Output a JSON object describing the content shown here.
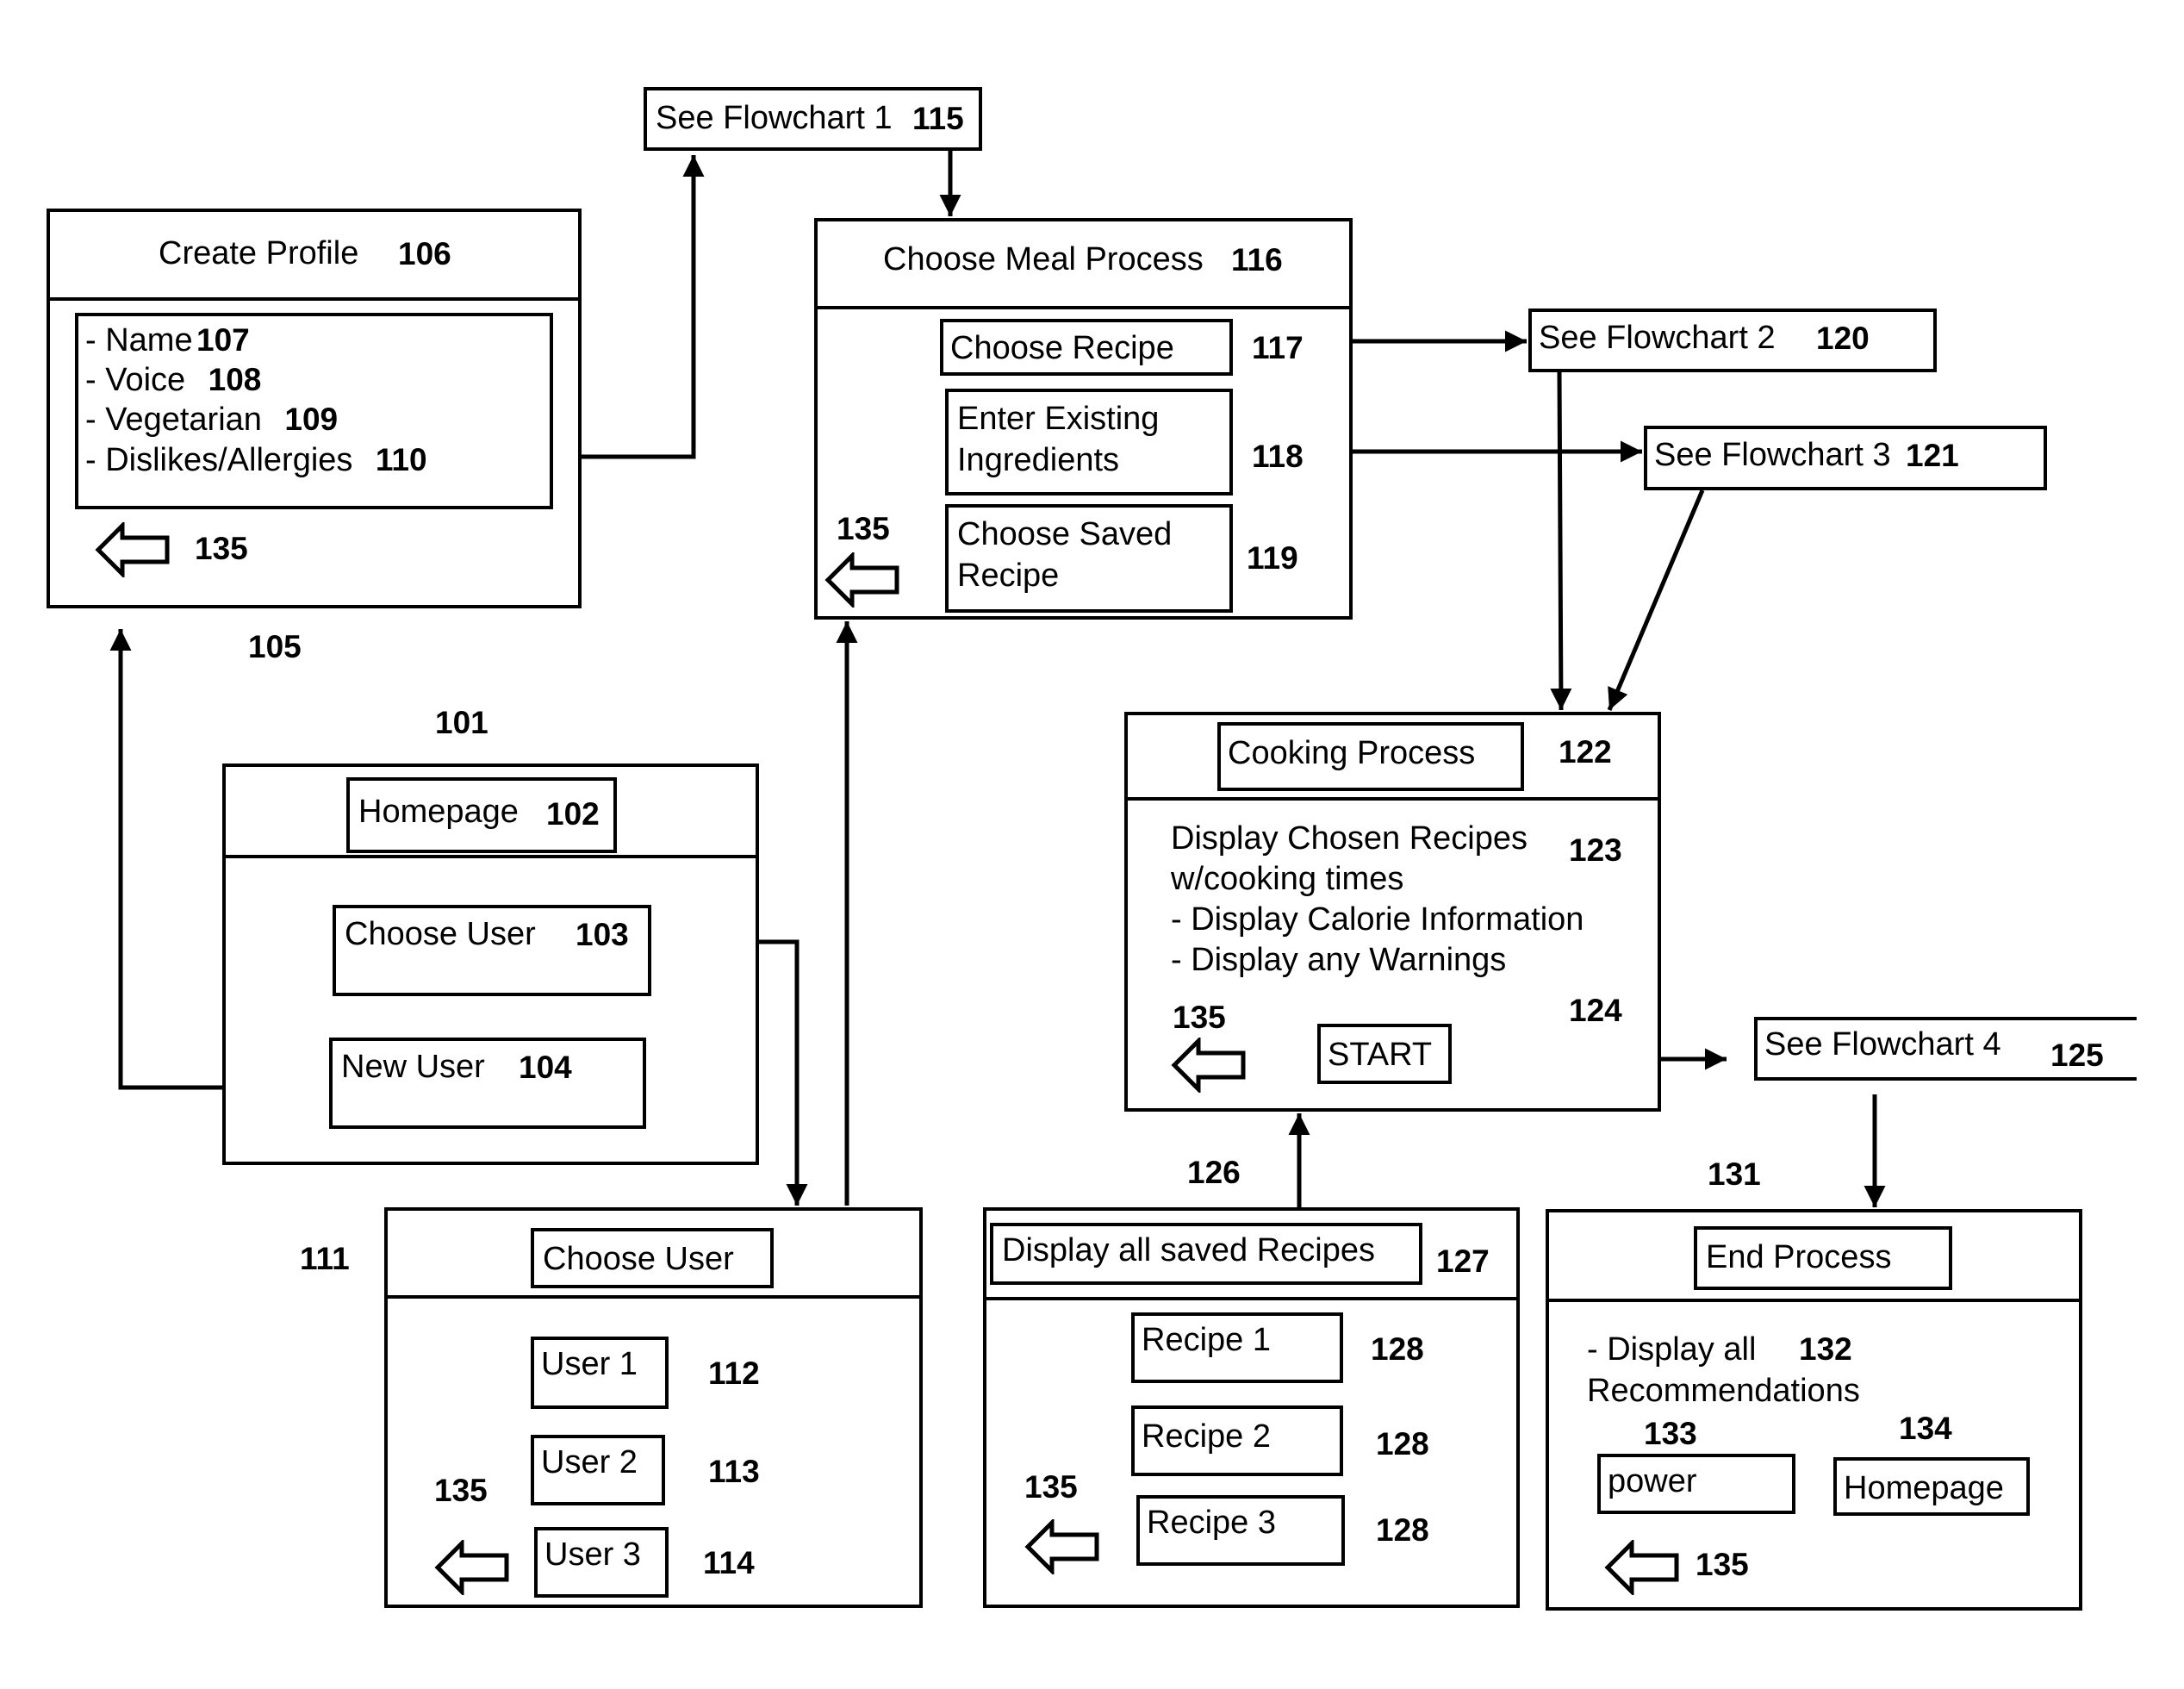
{
  "diagram": {
    "flowchart_refs": {
      "fc1": {
        "label": "See Flowchart 1",
        "ref": "115"
      },
      "fc2": {
        "label": "See Flowchart 2",
        "ref": "120"
      },
      "fc3": {
        "label": "See Flowchart 3",
        "ref": "121"
      },
      "fc4": {
        "label": "See Flowchart 4",
        "ref": "125"
      }
    },
    "create_profile": {
      "ref": "105",
      "title": "Create Profile",
      "title_ref": "106",
      "fields": [
        {
          "label": "- Name",
          "ref": "107"
        },
        {
          "label": "- Voice",
          "ref": "108"
        },
        {
          "label": "- Vegetarian",
          "ref": "109"
        },
        {
          "label": "- Dislikes/Allergies",
          "ref": "110"
        }
      ],
      "back_ref": "135"
    },
    "choose_meal": {
      "title": "Choose Meal Process",
      "title_ref": "116",
      "options": [
        {
          "label": "Choose Recipe",
          "ref": "117"
        },
        {
          "label": "Enter Existing\nIngredients",
          "ref": "118"
        },
        {
          "label": "Choose Saved\nRecipe",
          "ref": "119"
        }
      ],
      "back_ref": "135"
    },
    "homepage": {
      "ref": "101",
      "title": "Homepage",
      "title_ref": "102",
      "buttons": [
        {
          "label": "Choose User",
          "ref": "103"
        },
        {
          "label": "New User",
          "ref": "104"
        }
      ]
    },
    "cooking": {
      "title": "Cooking Process",
      "title_ref": "122",
      "text": "Display Chosen Recipes\nw/cooking times\n- Display Calorie Information\n- Display any Warnings",
      "text_ref": "123",
      "start_label": "START",
      "start_ref": "124",
      "back_ref": "135"
    },
    "choose_user": {
      "ref": "111",
      "title": "Choose User",
      "users": [
        {
          "label": "User 1",
          "ref": "112"
        },
        {
          "label": "User 2",
          "ref": "113"
        },
        {
          "label": "User 3",
          "ref": "114"
        }
      ],
      "back_ref": "135"
    },
    "saved_recipes": {
      "ref": "126",
      "title": "Display all saved Recipes",
      "title_ref": "127",
      "recipes": [
        {
          "label": "Recipe 1",
          "ref": "128"
        },
        {
          "label": "Recipe 2",
          "ref": "128"
        },
        {
          "label": "Recipe 3",
          "ref": "128"
        }
      ],
      "back_ref": "135"
    },
    "end_process": {
      "ref": "131",
      "title": "End Process",
      "text": "- Display all\nRecommendations",
      "text_ref": "132",
      "power_label": "power",
      "power_ref": "133",
      "home_label": "Homepage",
      "home_ref": "134",
      "back_ref": "135"
    }
  }
}
